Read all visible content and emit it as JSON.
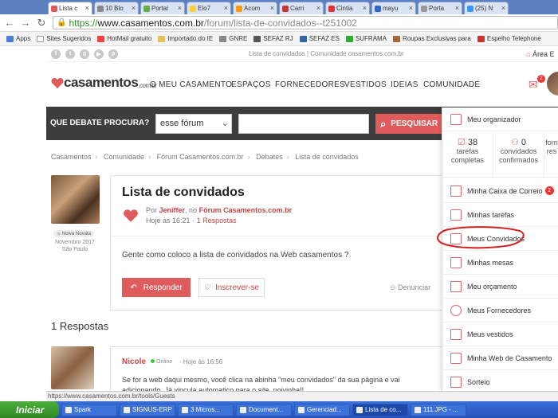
{
  "browser": {
    "tabs": [
      {
        "label": "Lista c"
      },
      {
        "label": "10 Blo"
      },
      {
        "label": "Portal"
      },
      {
        "label": "Elo7"
      },
      {
        "label": "Acom"
      },
      {
        "label": "Carri"
      },
      {
        "label": "Cintia"
      },
      {
        "label": "mayu"
      },
      {
        "label": "Porta"
      },
      {
        "label": "(25) N"
      }
    ],
    "url_scheme": "https://",
    "url_host": "www.casamentos.com.br",
    "url_path": "/forum/lista-de-convidados--t251002",
    "bookmarks": [
      "Apps",
      "Sites Sugeridos",
      "HotMail gratuito",
      "Importado do IE",
      "GNRE",
      "SEFAZ RJ",
      "SEFAZ ES",
      "SUFRAMA",
      "Roupas Exclusivas para",
      "Espelho Telephone"
    ]
  },
  "site": {
    "topstrip_text": "Lista de convidados | Comunidade casamentos.com.br",
    "area": "Área E",
    "logo_text": "casamentos",
    "logo_suffix": ".com.br",
    "nav": [
      "O MEU CASAMENTO",
      "ESPAÇOS",
      "FORNECEDORES",
      "VESTIDOS",
      "IDEIAS",
      "COMUNIDADE"
    ],
    "mail_badge": "2"
  },
  "search": {
    "label": "QUE DEBATE PROCURA?",
    "scope": "esse fórum",
    "button": "PESQUISAR"
  },
  "breadcrumb": [
    "Casamentos",
    "Comunidade",
    "Fórum Casamentos.com.br",
    "Debates",
    "Lista de convidados"
  ],
  "author": {
    "badge": "Noiva Novata",
    "joined": "Novembro 2017",
    "location": "São Paulo"
  },
  "post": {
    "title": "Lista de convidados",
    "by": "Por",
    "author": "Jeniffer",
    "in": ", no",
    "forum": "Fórum Casamentos.com.br",
    "time": "Hoje às 16:21 ·",
    "replies": "1 Respostas",
    "body": "Gente como coloco a lista de convidados na Web casamentos ?",
    "reply_btn": "Responder",
    "subscribe_btn": "Inscrever-se",
    "report": "Denunciar"
  },
  "responses": {
    "title": "1 Respostas",
    "items": [
      {
        "name": "Nicole",
        "status": "Online",
        "time": "· Hoje às 16:56",
        "text": "Se for a web daqui mesmo, você clica na abinha \"meu convidados\" da sua página e vai adicionando. Já vincula automatico para o site. noivinha!!"
      }
    ]
  },
  "panel": {
    "header": "Meu organizador",
    "counters": [
      {
        "value": "38",
        "label": "tarefas completas"
      },
      {
        "value": "0",
        "label": "convidados confirmados"
      },
      {
        "value": "",
        "label": "forn res"
      }
    ],
    "items": [
      {
        "label": "Minha Caixa de Correio",
        "badge": "2"
      },
      {
        "label": "Minhas tarefas"
      },
      {
        "label": "Meus Convidados"
      },
      {
        "label": "Minhas mesas"
      },
      {
        "label": "Meu orçamento"
      },
      {
        "label": "Meus Fornecedores"
      },
      {
        "label": "Meus vestidos"
      },
      {
        "label": "Minha Web de Casamento"
      },
      {
        "label": "Sorteio"
      }
    ]
  },
  "statusbar": "https://www.casamentos.com.br/tools/Guests",
  "taskbar": {
    "start": "Iniciar",
    "tasks": [
      "Spark",
      "SIGNUS-ERP",
      "3 Micros...",
      "Document...",
      "Gerenciad...",
      "Lista de co...",
      "111.JPG - ..."
    ]
  },
  "colors": {
    "accent": "#e05b5b",
    "dark_bar": "#3d3d3d",
    "annotation": "#d22222"
  }
}
